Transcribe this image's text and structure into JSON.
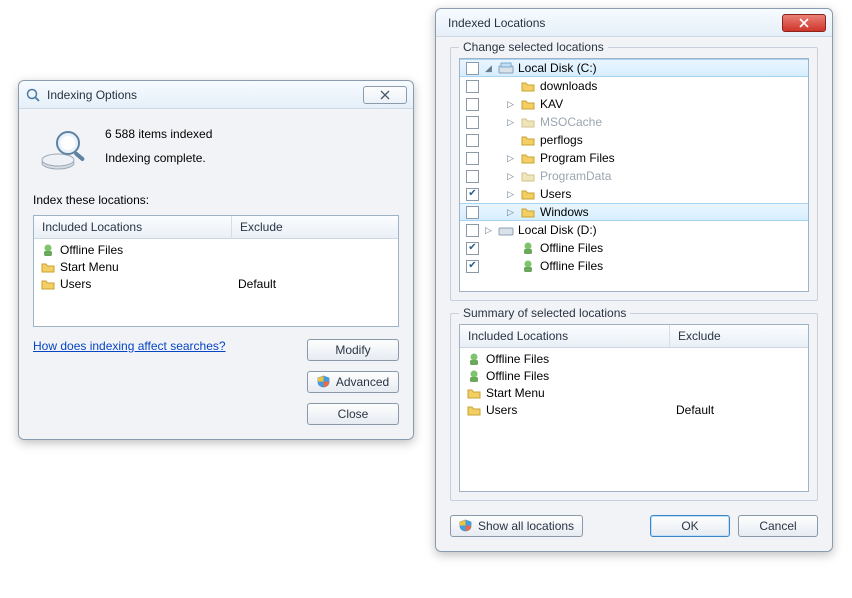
{
  "opts": {
    "title": "Indexing Options",
    "count_line": "6 588 items indexed",
    "status_line": "Indexing complete.",
    "section_label": "Index these locations:",
    "columns": {
      "included": "Included Locations",
      "exclude": "Exclude"
    },
    "rows": [
      {
        "name": "Offline Files",
        "exclude": ""
      },
      {
        "name": "Start Menu",
        "exclude": ""
      },
      {
        "name": "Users",
        "exclude": "Default"
      }
    ],
    "help_link": "How does indexing affect searches?",
    "buttons": {
      "modify": "Modify",
      "advanced": "Advanced",
      "close": "Close"
    }
  },
  "loc": {
    "title": "Indexed Locations",
    "group_change": "Change selected locations",
    "group_summary": "Summary of selected locations",
    "tree": {
      "root": {
        "name": "Local Disk (C:)",
        "checked": false
      },
      "children": [
        {
          "name": "downloads",
          "checked": false,
          "expandable": false,
          "dim": false
        },
        {
          "name": "KAV",
          "checked": false,
          "expandable": true,
          "dim": false
        },
        {
          "name": "MSOCache",
          "checked": false,
          "expandable": true,
          "dim": true
        },
        {
          "name": "perflogs",
          "checked": false,
          "expandable": false,
          "dim": false
        },
        {
          "name": "Program Files",
          "checked": false,
          "expandable": true,
          "dim": false
        },
        {
          "name": "ProgramData",
          "checked": false,
          "expandable": true,
          "dim": true
        },
        {
          "name": "Users",
          "checked": true,
          "expandable": true,
          "dim": false
        },
        {
          "name": "Windows",
          "checked": false,
          "expandable": true,
          "dim": false
        }
      ],
      "root2": {
        "name": "Local Disk (D:)",
        "checked": false
      },
      "offline1": {
        "name": "Offline Files",
        "checked": true
      },
      "offline2": {
        "name": "Offline Files",
        "checked": true
      }
    },
    "summary_columns": {
      "included": "Included Locations",
      "exclude": "Exclude"
    },
    "summary_rows": [
      {
        "name": "Offline Files",
        "exclude": ""
      },
      {
        "name": "Offline Files",
        "exclude": ""
      },
      {
        "name": "Start Menu",
        "exclude": ""
      },
      {
        "name": "Users",
        "exclude": "Default"
      }
    ],
    "buttons": {
      "showall": "Show all locations",
      "ok": "OK",
      "cancel": "Cancel"
    }
  }
}
